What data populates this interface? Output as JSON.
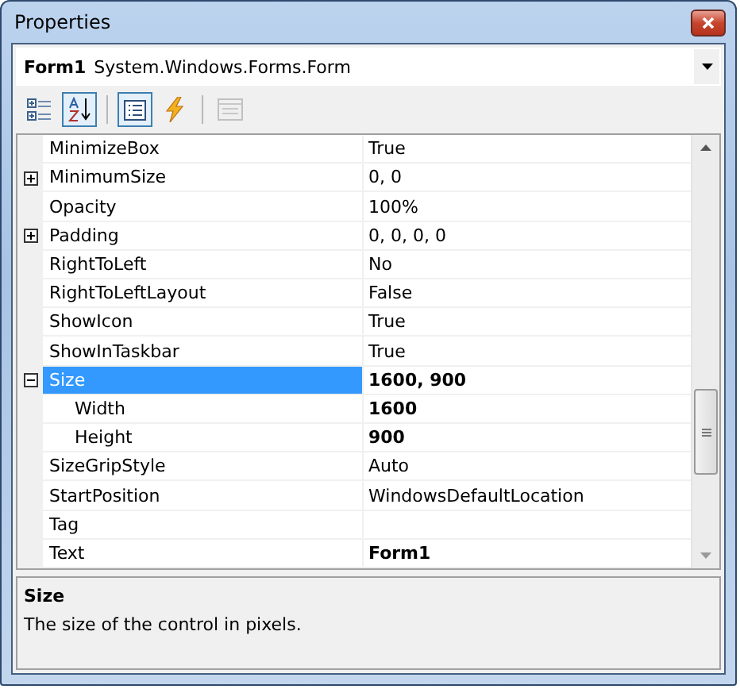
{
  "window": {
    "title": "Properties"
  },
  "object_selector": {
    "name": "Form1",
    "type": "System.Windows.Forms.Form"
  },
  "toolbar": [
    {
      "kind": "categorized",
      "selected": false,
      "disabled": false
    },
    {
      "kind": "alphabetical",
      "selected": true,
      "disabled": false
    },
    {
      "kind": "properties",
      "selected": true,
      "disabled": false
    },
    {
      "kind": "events",
      "selected": false,
      "disabled": false
    },
    {
      "kind": "property_pages",
      "selected": false,
      "disabled": true
    }
  ],
  "properties": [
    {
      "name": "MinimizeBox",
      "value": "True",
      "modified": false,
      "selected": false
    },
    {
      "name": "MinimumSize",
      "value": "0, 0",
      "modified": false,
      "selected": false,
      "expanded": false
    },
    {
      "name": "Opacity",
      "value": "100%",
      "modified": false,
      "selected": false
    },
    {
      "name": "Padding",
      "value": "0, 0, 0, 0",
      "modified": false,
      "selected": false,
      "expanded": false
    },
    {
      "name": "RightToLeft",
      "value": "No",
      "modified": false,
      "selected": false
    },
    {
      "name": "RightToLeftLayout",
      "value": "False",
      "modified": false,
      "selected": false
    },
    {
      "name": "ShowIcon",
      "value": "True",
      "modified": false,
      "selected": false
    },
    {
      "name": "ShowInTaskbar",
      "value": "True",
      "modified": false,
      "selected": false
    },
    {
      "name": "Size",
      "value": "1600, 900",
      "modified": true,
      "selected": true,
      "expanded": true,
      "children": [
        {
          "name": "Width",
          "value": "1600",
          "modified": true,
          "selected": false
        },
        {
          "name": "Height",
          "value": "900",
          "modified": true,
          "selected": false
        }
      ]
    },
    {
      "name": "SizeGripStyle",
      "value": "Auto",
      "modified": false,
      "selected": false
    },
    {
      "name": "StartPosition",
      "value": "WindowsDefaultLocation",
      "modified": false,
      "selected": false
    },
    {
      "name": "Tag",
      "modified": false,
      "selected": false
    },
    {
      "name": "Text",
      "value": "Form1",
      "modified": true,
      "selected": false
    }
  ],
  "description": {
    "title": "Size",
    "text": "The size of the control in pixels."
  }
}
